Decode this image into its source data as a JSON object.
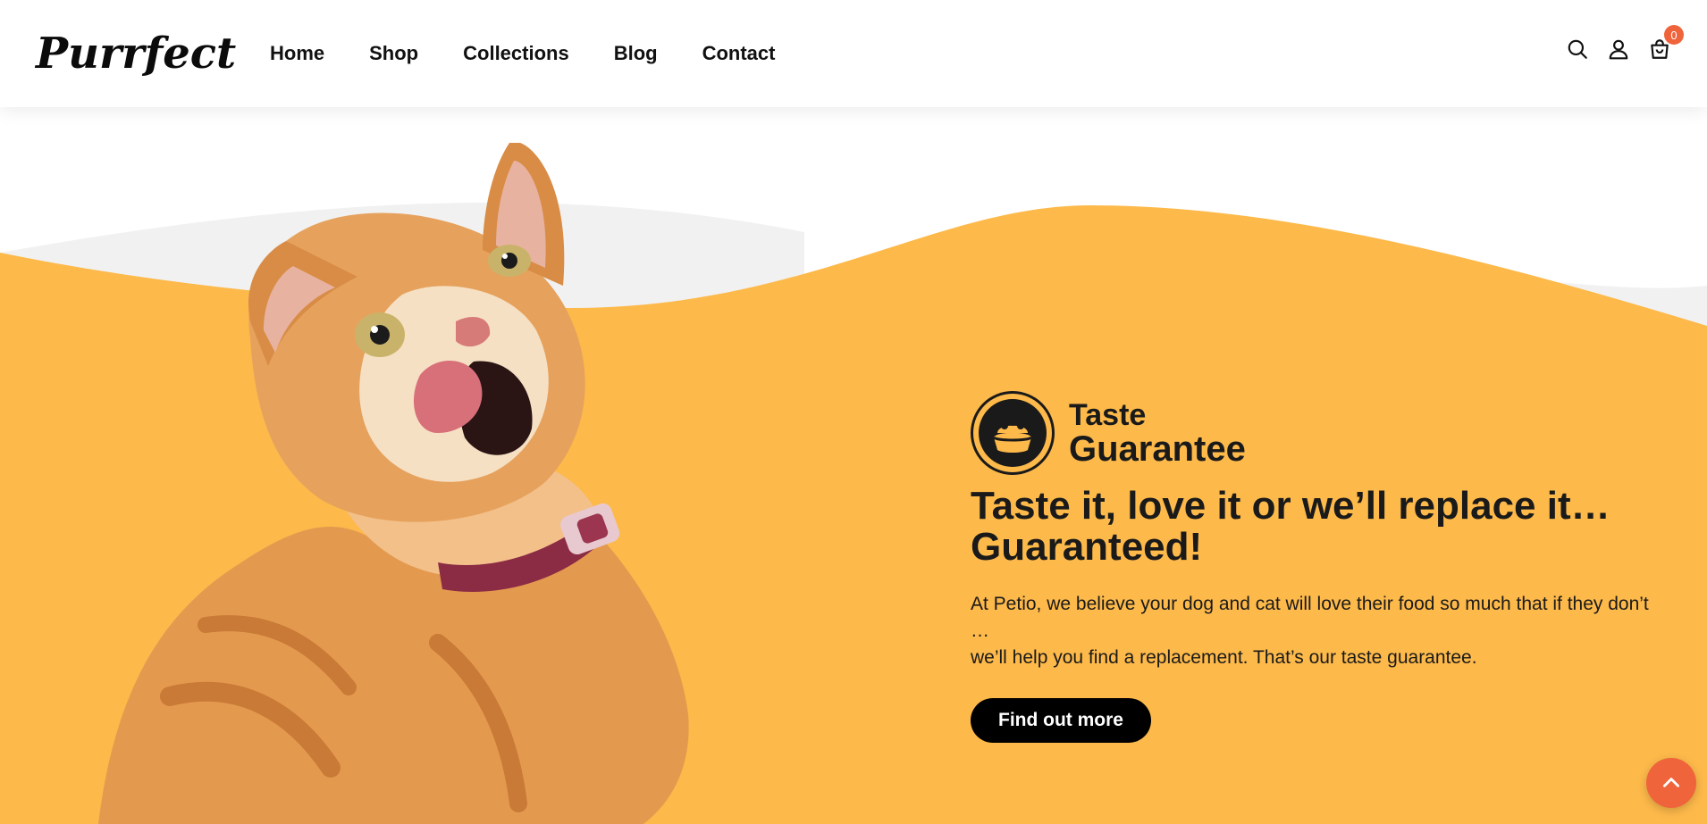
{
  "header": {
    "logo": "Purrfect",
    "nav": [
      {
        "label": "Home"
      },
      {
        "label": "Shop"
      },
      {
        "label": "Collections"
      },
      {
        "label": "Blog"
      },
      {
        "label": "Contact"
      }
    ],
    "icons": [
      "search-icon",
      "account-icon",
      "cart-icon"
    ],
    "cart_count": "0"
  },
  "hero": {
    "badge_line1": "Taste",
    "badge_line2": "Guarantee",
    "headline_line1": "Taste it, love it or we’ll replace it…",
    "headline_line2": "Guaranteed!",
    "desc_line1": "At Petio, we believe your dog and cat will love their food so much that if they don’t …",
    "desc_line2": "we’ll help you find a replacement. That’s our taste guarantee.",
    "cta_label": "Find out more"
  },
  "colors": {
    "hero_bg": "#fdb94a",
    "accent": "#f0643c",
    "text": "#1a1a1a",
    "button_bg": "#000000"
  }
}
